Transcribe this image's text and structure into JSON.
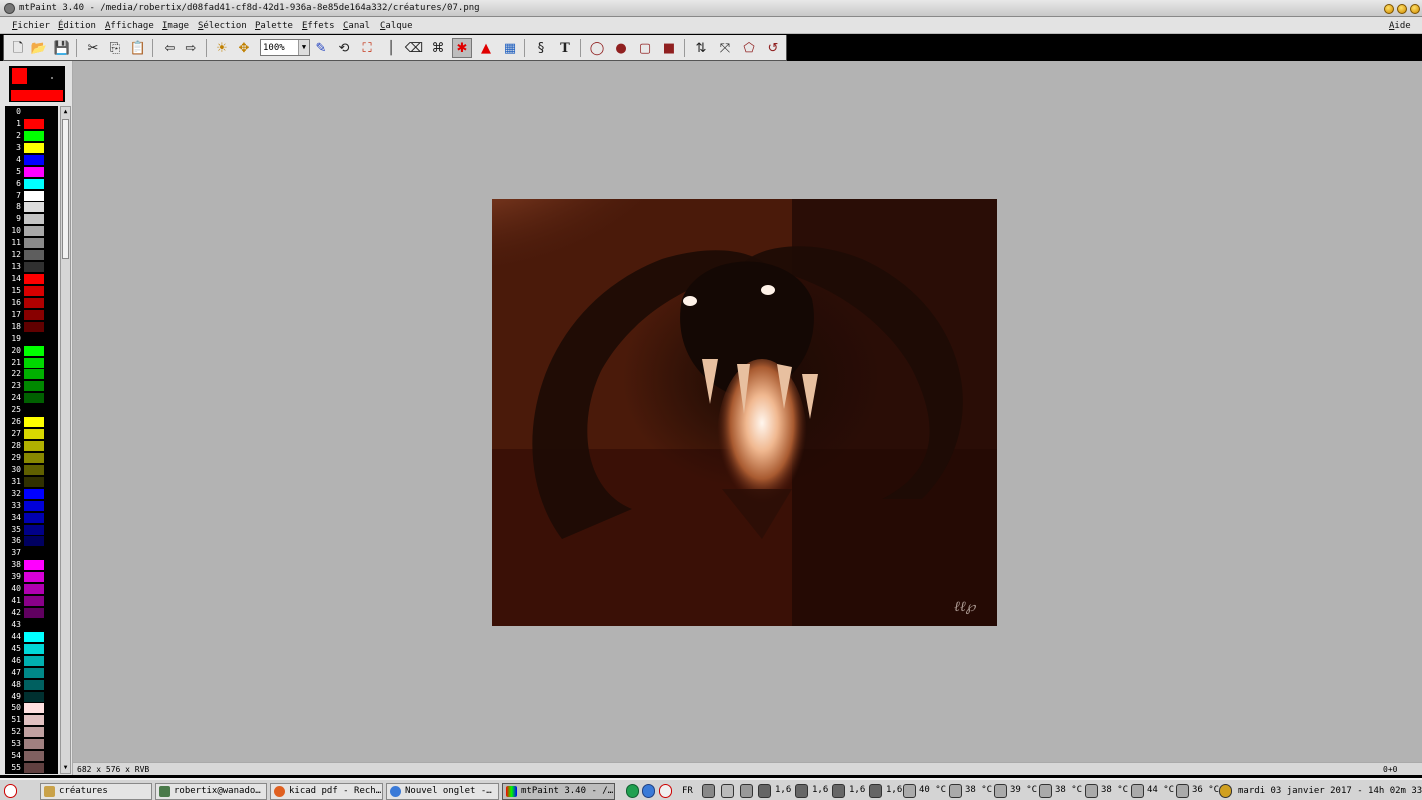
{
  "window": {
    "title": "mtPaint 3.40 - /media/robertix/d08fad41-cf8d-42d1-936a-8e85de164a332/créatures/07.png"
  },
  "menu": {
    "left": [
      "Fichier",
      "Édition",
      "Affichage",
      "Image",
      "Sélection",
      "Palette",
      "Effets",
      "Canal",
      "Calque"
    ],
    "right": "Aide"
  },
  "toolbar": {
    "icons": [
      "new-icon",
      "open-icon",
      "save-icon",
      "cut-icon",
      "copy-icon",
      "paste-icon",
      "undo-icon",
      "redo-icon",
      "pan-icon",
      "move-icon",
      "pencil-icon",
      "rotate-icon",
      "fill-icon",
      "line-icon",
      "eraser-icon",
      "clone-icon",
      "smudge-icon",
      "gradient-icon",
      "color-picker-icon",
      "brush-icon",
      "text-icon",
      "select-ellipse-icon",
      "fill-ellipse-icon",
      "outline-rect-icon",
      "fill-rect-icon",
      "flip-icon",
      "transform-icon",
      "polygon-icon",
      "lasso-icon"
    ],
    "zoom_value": "100%"
  },
  "colors": {
    "foreground": "#ff0000",
    "background": "#000000",
    "pattern": "#ff0000"
  },
  "palette": [
    {
      "index": "0",
      "color": "#000000"
    },
    {
      "index": "1",
      "color": "#ff0000"
    },
    {
      "index": "2",
      "color": "#00ff00"
    },
    {
      "index": "3",
      "color": "#ffff00"
    },
    {
      "index": "4",
      "color": "#0000ff"
    },
    {
      "index": "5",
      "color": "#ff00ff"
    },
    {
      "index": "6",
      "color": "#00ffff"
    },
    {
      "index": "7",
      "color": "#ffffff"
    },
    {
      "index": "8",
      "color": "#dcdcdc"
    },
    {
      "index": "9",
      "color": "#c4c4c4"
    },
    {
      "index": "10",
      "color": "#a8a8a8"
    },
    {
      "index": "11",
      "color": "#8a8a8a"
    },
    {
      "index": "12",
      "color": "#5e5e5e"
    },
    {
      "index": "13",
      "color": "#303030"
    },
    {
      "index": "14",
      "color": "#ff0000"
    },
    {
      "index": "15",
      "color": "#d80000"
    },
    {
      "index": "16",
      "color": "#b00000"
    },
    {
      "index": "17",
      "color": "#880000"
    },
    {
      "index": "18",
      "color": "#600000"
    },
    {
      "index": "19",
      "color": "#000000"
    },
    {
      "index": "20",
      "color": "#00ff00"
    },
    {
      "index": "21",
      "color": "#00d800"
    },
    {
      "index": "22",
      "color": "#00b000"
    },
    {
      "index": "23",
      "color": "#008800"
    },
    {
      "index": "24",
      "color": "#006000"
    },
    {
      "index": "25",
      "color": "#000000"
    },
    {
      "index": "26",
      "color": "#ffff00"
    },
    {
      "index": "27",
      "color": "#d8d800"
    },
    {
      "index": "28",
      "color": "#b0b000"
    },
    {
      "index": "29",
      "color": "#888800"
    },
    {
      "index": "30",
      "color": "#606000"
    },
    {
      "index": "31",
      "color": "#303000"
    },
    {
      "index": "32",
      "color": "#0000ff"
    },
    {
      "index": "33",
      "color": "#0000d8"
    },
    {
      "index": "34",
      "color": "#0000b0"
    },
    {
      "index": "35",
      "color": "#000088"
    },
    {
      "index": "36",
      "color": "#000060"
    },
    {
      "index": "37",
      "color": "#000000"
    },
    {
      "index": "38",
      "color": "#ff00ff"
    },
    {
      "index": "39",
      "color": "#d800d8"
    },
    {
      "index": "40",
      "color": "#b000b0"
    },
    {
      "index": "41",
      "color": "#880088"
    },
    {
      "index": "42",
      "color": "#600060"
    },
    {
      "index": "43",
      "color": "#000000"
    },
    {
      "index": "44",
      "color": "#00ffff"
    },
    {
      "index": "45",
      "color": "#00d8d8"
    },
    {
      "index": "46",
      "color": "#00b0b0"
    },
    {
      "index": "47",
      "color": "#008888"
    },
    {
      "index": "48",
      "color": "#006060"
    },
    {
      "index": "49",
      "color": "#003030"
    },
    {
      "index": "50",
      "color": "#ffe0e0"
    },
    {
      "index": "51",
      "color": "#e0c0c0"
    },
    {
      "index": "52",
      "color": "#c0a0a0"
    },
    {
      "index": "53",
      "color": "#a08080"
    },
    {
      "index": "54",
      "color": "#806060"
    },
    {
      "index": "55",
      "color": "#604040"
    }
  ],
  "status": {
    "image_info": "682 x 576 x RVB",
    "cursor": "0+0"
  },
  "taskbar": {
    "tasks": [
      {
        "label": "créatures",
        "color": "#c9a24a"
      },
      {
        "label": "robertix@wanado…",
        "color": "#4a7a4a"
      },
      {
        "label": "kicad pdf - Rech…",
        "color": "#e06020"
      },
      {
        "label": "Nouvel onglet -…",
        "color": "#3a7ad8"
      },
      {
        "label": "mtPaint 3.40 - /…",
        "color": "#6a3a8a"
      }
    ],
    "keyboard": "FR",
    "sensors": [
      "1,6",
      "1,6",
      "1,6",
      "1,6",
      "40 °C",
      "38 °C",
      "39 °C",
      "38 °C",
      "38 °C",
      "44 °C",
      "36 °C"
    ],
    "clock": "mardi 03 janvier 2017 - 14h 02m 33s"
  }
}
